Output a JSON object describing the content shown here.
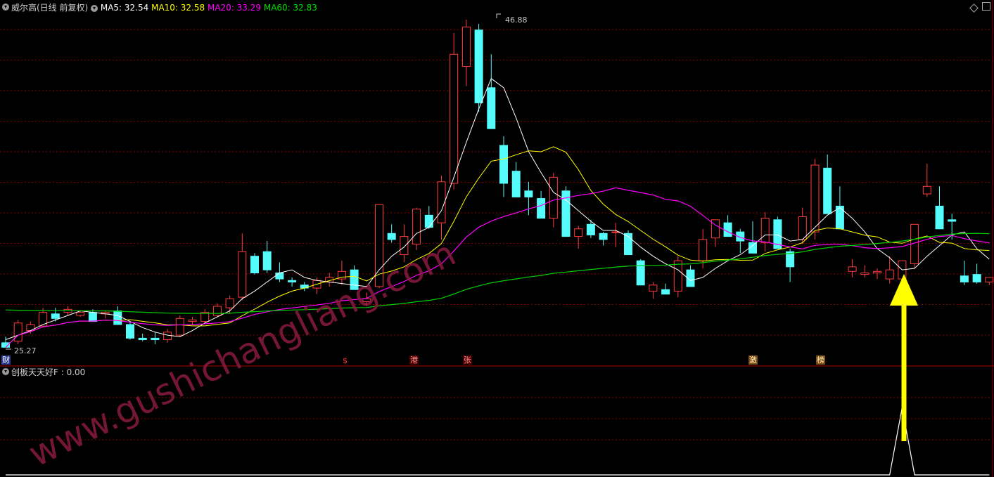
{
  "main_header": {
    "title": "威尔高(日线 前复权)",
    "ma5_label": "MA5: 32.54",
    "ma10_label": "MA10: 32.58",
    "ma20_label": "MA20: 33.29",
    "ma60_label": "MA60: 32.83"
  },
  "sub_header": {
    "label": "创板天天好F : 0.00"
  },
  "event_markers": [
    "财",
    "$",
    "港",
    "张",
    "激",
    "榜"
  ],
  "watermark": "www.gushichangliang.com",
  "colors": {
    "up": "#ff3c3c",
    "down": "#54fcfc",
    "ma5": "#ffffff",
    "ma10": "#ffff00",
    "ma20": "#ff00ff",
    "ma60": "#00d000",
    "grid": "#8b0000",
    "arrow": "#ffff00",
    "indicator": "#ffffff",
    "title": "#d0d0d0"
  },
  "icons": [
    "collapse-circle-icon",
    "diamond-icon",
    "yellow-arrow-icon"
  ],
  "chart_data": [
    {
      "type": "candlestick",
      "title": "威尔高(日线 前复权)",
      "annotations": {
        "high": "46.88",
        "low": "25.27"
      },
      "ohlc": [
        [
          25.6,
          26.0,
          25.27,
          25.3
        ],
        [
          25.7,
          27.1,
          25.5,
          26.9
        ],
        [
          26.4,
          27.0,
          26.2,
          26.8
        ],
        [
          26.7,
          27.9,
          26.6,
          27.6
        ],
        [
          27.5,
          27.9,
          27.0,
          27.2
        ],
        [
          27.6,
          28.0,
          27.4,
          27.8
        ],
        [
          27.4,
          27.7,
          27.3,
          27.6
        ],
        [
          27.6,
          27.8,
          27.2,
          27.0
        ],
        [
          27.5,
          27.7,
          27.2,
          27.6
        ],
        [
          27.7,
          28.0,
          27.0,
          26.8
        ],
        [
          26.8,
          27.0,
          25.8,
          25.9
        ],
        [
          25.9,
          26.2,
          25.7,
          25.8
        ],
        [
          25.9,
          26.3,
          25.5,
          25.8
        ],
        [
          25.8,
          26.5,
          25.6,
          26.3
        ],
        [
          26.1,
          27.4,
          26.0,
          27.2
        ],
        [
          27.0,
          27.3,
          26.8,
          27.1
        ],
        [
          27.0,
          27.8,
          26.9,
          27.6
        ],
        [
          27.4,
          28.2,
          27.3,
          28.0
        ],
        [
          27.9,
          28.7,
          27.5,
          28.5
        ],
        [
          28.6,
          32.8,
          28.4,
          31.6
        ],
        [
          31.3,
          31.5,
          30.1,
          30.2
        ],
        [
          31.6,
          32.3,
          30.2,
          30.4
        ],
        [
          30.2,
          30.9,
          29.6,
          29.8
        ],
        [
          29.7,
          29.9,
          29.3,
          29.6
        ],
        [
          29.4,
          29.6,
          29.0,
          29.2
        ],
        [
          29.2,
          29.9,
          28.8,
          29.7
        ],
        [
          29.6,
          30.2,
          29.3,
          29.9
        ],
        [
          29.8,
          31.0,
          29.4,
          30.3
        ],
        [
          30.4,
          30.7,
          29.2,
          29.1
        ],
        [
          28.3,
          28.9,
          28.0,
          28.5
        ],
        [
          29.3,
          34.7,
          29.2,
          34.7
        ],
        [
          32.8,
          33.4,
          32.2,
          32.4
        ],
        [
          31.4,
          33.4,
          30.9,
          32.6
        ],
        [
          32.1,
          34.5,
          31.7,
          34.4
        ],
        [
          34.0,
          34.6,
          33.1,
          33.2
        ],
        [
          33.5,
          36.6,
          32.4,
          36.2
        ],
        [
          36.1,
          46.0,
          35.7,
          44.6
        ],
        [
          43.8,
          46.88,
          42.5,
          46.4
        ],
        [
          46.2,
          46.6,
          40.8,
          41.4
        ],
        [
          42.4,
          44.6,
          39.8,
          39.7
        ],
        [
          38.6,
          39.2,
          35.2,
          36.1
        ],
        [
          36.9,
          37.5,
          35.8,
          35.2
        ],
        [
          35.6,
          36.2,
          34.0,
          35.2
        ],
        [
          35.1,
          35.6,
          33.9,
          33.8
        ],
        [
          33.8,
          36.8,
          33.2,
          36.5
        ],
        [
          35.6,
          35.9,
          32.6,
          32.6
        ],
        [
          32.6,
          33.3,
          31.8,
          33.1
        ],
        [
          33.4,
          33.7,
          32.5,
          32.7
        ],
        [
          32.8,
          32.9,
          32.0,
          32.4
        ],
        [
          32.9,
          33.5,
          31.9,
          32.9
        ],
        [
          32.8,
          33.0,
          31.4,
          31.4
        ],
        [
          31.0,
          31.1,
          29.4,
          29.4
        ],
        [
          29.0,
          29.6,
          28.5,
          29.4
        ],
        [
          29.1,
          29.5,
          28.8,
          28.8
        ],
        [
          29.0,
          31.3,
          28.6,
          31.0
        ],
        [
          30.4,
          30.7,
          29.4,
          29.3
        ],
        [
          31.0,
          33.1,
          30.5,
          32.4
        ],
        [
          32.5,
          33.5,
          31.9,
          33.7
        ],
        [
          33.5,
          34.0,
          32.6,
          32.6
        ],
        [
          32.9,
          33.1,
          31.5,
          32.3
        ],
        [
          32.2,
          33.6,
          31.8,
          31.5
        ],
        [
          32.2,
          34.2,
          31.6,
          33.8
        ],
        [
          33.7,
          33.9,
          31.8,
          31.8
        ],
        [
          31.6,
          31.8,
          29.6,
          30.6
        ],
        [
          32.4,
          34.5,
          32.1,
          33.9
        ],
        [
          32.9,
          37.7,
          32.4,
          37.3
        ],
        [
          37.1,
          38.0,
          34.4,
          34.1
        ],
        [
          34.6,
          35.9,
          33.2,
          33.1
        ],
        [
          30.3,
          31.1,
          29.9,
          30.6
        ],
        [
          30.1,
          30.7,
          29.9,
          30.2
        ],
        [
          30.2,
          30.5,
          29.8,
          30.3
        ],
        [
          29.8,
          31.3,
          29.5,
          30.4
        ],
        [
          29.8,
          30.9,
          28.6,
          31.0
        ],
        [
          30.8,
          33.4,
          30.5,
          33.4
        ],
        [
          35.4,
          37.4,
          35.2,
          35.9
        ],
        [
          34.6,
          35.9,
          33.1,
          33.1
        ],
        [
          33.7,
          34.1,
          32.4,
          33.6
        ],
        [
          30.0,
          31.0,
          29.4,
          29.6
        ],
        [
          30.1,
          30.8,
          29.5,
          29.6
        ],
        [
          29.6,
          29.8,
          29.4,
          29.9
        ]
      ],
      "ma5": [
        25.8,
        26.1,
        26.4,
        26.8,
        27.1,
        27.4,
        27.7,
        27.6,
        27.5,
        27.4,
        27.0,
        26.6,
        26.3,
        26.1,
        26.0,
        26.4,
        26.9,
        27.3,
        27.7,
        28.5,
        29.0,
        29.6,
        30.2,
        30.4,
        29.9,
        29.7,
        29.6,
        29.5,
        29.4,
        29.3,
        30.4,
        31.3,
        31.9,
        32.8,
        33.2,
        34.3,
        36.5,
        38.8,
        41.0,
        43.0,
        42.4,
        40.4,
        38.2,
        36.8,
        35.5,
        35.0,
        34.3,
        33.6,
        33.0,
        33.0,
        32.6,
        31.9,
        31.3,
        30.8,
        30.4,
        29.7,
        29.9,
        30.5,
        31.0,
        31.4,
        32.0,
        32.7,
        32.7,
        32.3,
        32.4,
        33.2,
        34.0,
        34.5,
        33.8,
        32.9,
        31.8,
        31.2,
        30.4,
        30.5,
        31.3,
        32.0,
        32.7,
        32.9,
        31.8,
        31.1
      ]
    },
    {
      "type": "line",
      "series": [
        {
          "name": "创板天天好F",
          "values": [
            0,
            0,
            0,
            0,
            0,
            0,
            0,
            0,
            0,
            0,
            0,
            0,
            0,
            0,
            0,
            0,
            0,
            0,
            0,
            0,
            0,
            0,
            0,
            0,
            0,
            0,
            0,
            0,
            0,
            0,
            0,
            0,
            0,
            0,
            0,
            0,
            0,
            0,
            0,
            0,
            0,
            0,
            0,
            0,
            0,
            0,
            0,
            0,
            0,
            0,
            0,
            0,
            0,
            0,
            0,
            0,
            0,
            0,
            0,
            0,
            0,
            0,
            0,
            0,
            0,
            0,
            0,
            0,
            0,
            0,
            0,
            0,
            1,
            0,
            0,
            0,
            0,
            0,
            0,
            0
          ]
        }
      ],
      "ylim": [
        0,
        1
      ]
    }
  ]
}
